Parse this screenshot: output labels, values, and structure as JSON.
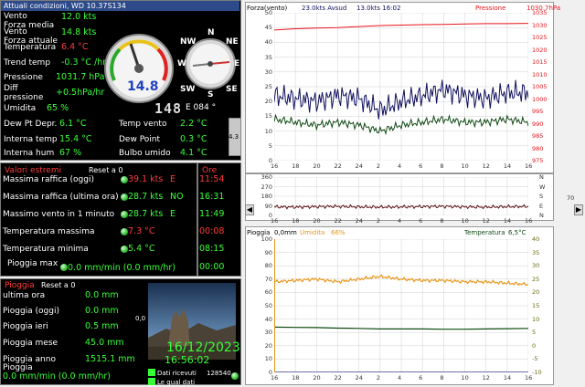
{
  "conditions": {
    "title": "Attuali condizioni, WD 10.37S134",
    "wind_avg_label": "Vento\nForza media",
    "wind_avg": "12.0 kts",
    "wind_now_label": "Vento\nForza attuale",
    "wind_now": "14.8 kts",
    "temp_label": "Temperatura",
    "temp": "6.4 °C",
    "trend_label": "Trend temp",
    "trend": "-0.3 °C /hr",
    "pressure_label": "Pressione",
    "pressure": "1031.7 hPa",
    "diff_label": "Diff\npressione",
    "diff": "+0.5hPa/hr",
    "humidity_label": "Umidita",
    "humidity": "65 %",
    "dew_label": "Dew Pt Depr.",
    "dew": "6.1 °C",
    "int_temp_label": "Interna temp",
    "int_temp": "15.4 °C",
    "int_hum_label": "Interna hum",
    "int_hum": "67 %",
    "wind_temp_label": "Temp vento",
    "wind_temp": "2.2 °C",
    "dew_point_label": "Dew Point",
    "dew_point": "0.3 °C",
    "wet_bulb_label": "Bulbo umido",
    "wet_bulb": "4.1 °C",
    "gauge_value": "14.8",
    "lcd_value": "148",
    "compass": {
      "nw": "NW",
      "n": "N",
      "ne": "NE",
      "w": "W",
      "e": "E",
      "sw": "SW",
      "s": "S",
      "se": "SE"
    },
    "direction": "E  084 °",
    "side_value": "4.3"
  },
  "extremes": {
    "title": "Valori estremi",
    "reset": "Reset a 0",
    "time_title": "Ore",
    "rows": [
      {
        "label": "Massima raffica (oggi)",
        "value": "39.1 kts",
        "dir": "E",
        "time": "11:54",
        "color": "red"
      },
      {
        "label": "Massima raffica (ultima ora)",
        "value": "28.7 kts",
        "dir": "NO",
        "time": "16:31",
        "color": "green"
      },
      {
        "label": "Massimo vento in 1 minuto",
        "value": "28.7 kts",
        "dir": "E",
        "time": "11:49",
        "color": "green"
      },
      {
        "label": "Temperatura massima",
        "value": "7.3 °C",
        "dir": "",
        "time": "00:08",
        "color": "red"
      },
      {
        "label": "Temperatura minima",
        "value": "5.4 °C",
        "dir": "",
        "time": "08:15",
        "color": "green"
      }
    ],
    "rain_max_label": "Pioggia max",
    "rain_max": "0.0 mm/min (0.0 mm/hr)",
    "rain_max_time": "00:00"
  },
  "rain": {
    "title": "Pioggia",
    "reset": "Reset a 0",
    "rows": [
      {
        "label": "ultima ora",
        "value": "0.0 mm"
      },
      {
        "label": "Pioggia (oggi)",
        "value": "0.0 mm"
      },
      {
        "label": "Pioggia ieri",
        "value": "0.5 mm"
      },
      {
        "label": "Pioggia mese",
        "value": "45.0 mm"
      },
      {
        "label": "Pioggia anno",
        "value": "1515.1 mm"
      }
    ],
    "rate_label": "Pioggia",
    "rate": "0.0 mm/min (0.0 mm/hr)",
    "cam_scale": "0,0",
    "date": "16/12/2023",
    "time": "16:56:02",
    "data_received_label": "Dati ricevuti",
    "data_received": "128540",
    "last_data_label": "Le qual dati"
  },
  "chart_data": [
    {
      "type": "line",
      "title": "",
      "legend": [
        "Forza(vento)",
        "23.0kts Avsud",
        "13.0kts 16:02",
        "Pressione",
        "1030.7hPa"
      ],
      "x": [
        "16",
        "18",
        "20",
        "22",
        "24",
        "2",
        "4",
        "6",
        "8",
        "10",
        "12",
        "14",
        "16"
      ],
      "y_left": {
        "ticks": [
          "50",
          "45",
          "40",
          "35",
          "30",
          "25",
          "20",
          "15",
          "10",
          "5",
          "0"
        ],
        "ylim": [
          0,
          50
        ]
      },
      "y_right": {
        "ticks": [
          "1035",
          "1030",
          "1025",
          "1020",
          "1015",
          "1010",
          "1005",
          "1000",
          "995",
          "990",
          "985",
          "980",
          "975"
        ],
        "ylim": [
          975,
          1035
        ]
      },
      "series": [
        {
          "name": "Pressione",
          "color": "#e8141a",
          "values": [
            1028,
            1028.5,
            1028.8,
            1029,
            1029.4,
            1029.8,
            1030,
            1030.2,
            1030.3,
            1030.5,
            1030.6,
            1030.6,
            1030.7
          ]
        },
        {
          "name": "Forza(vento)",
          "color": "#10105e",
          "values": [
            22,
            21,
            20,
            22,
            21,
            17,
            20,
            22,
            24,
            22,
            21,
            23,
            23
          ]
        },
        {
          "name": "Avsud",
          "color": "#0f4a12",
          "values": [
            14,
            13,
            12,
            13,
            12,
            10,
            12,
            13,
            14,
            13,
            13,
            14,
            13
          ]
        }
      ]
    },
    {
      "type": "line",
      "y_left": {
        "ticks": [
          "360",
          "270",
          "180",
          "90",
          "0"
        ],
        "ylim": [
          0,
          360
        ]
      },
      "y_right_labels": [
        "N",
        "W",
        "S",
        "E",
        "N"
      ],
      "right_value": "70",
      "x": [
        "16",
        "18",
        "20",
        "22",
        "24",
        "2",
        "4",
        "6",
        "8",
        "10",
        "12",
        "14",
        "16"
      ],
      "series": [
        {
          "name": "Direzione",
          "color": "#5a1010",
          "values": [
            80,
            78,
            82,
            85,
            80,
            78,
            80,
            83,
            85,
            80,
            78,
            82,
            84
          ]
        }
      ]
    },
    {
      "type": "line",
      "legend": [
        "Pioggia",
        "0,0mm",
        "Umidita",
        "66%",
        "Temperatura",
        "6,5°C"
      ],
      "y_left": {
        "ticks": [
          "100",
          "90",
          "80",
          "70",
          "60",
          "50",
          "40",
          "30",
          "20",
          "10",
          "0"
        ],
        "ylim": [
          0,
          100
        ]
      },
      "y_right": {
        "ticks": [
          "40",
          "35",
          "30",
          "25",
          "20",
          "15",
          "10",
          "5",
          "0",
          "-5",
          "-10"
        ],
        "ylim": [
          -10,
          40
        ]
      },
      "x": [
        "16",
        "18",
        "20",
        "22",
        "24",
        "2",
        "4",
        "6",
        "8",
        "10",
        "12",
        "14",
        "16"
      ],
      "series": [
        {
          "name": "Umidita",
          "color": "#e8961a",
          "values": [
            68,
            69,
            70,
            68,
            70,
            72,
            70,
            69,
            69,
            68,
            68,
            67,
            66
          ]
        },
        {
          "name": "Temperatura",
          "color": "#0f4a12",
          "values": [
            7.0,
            6.9,
            6.8,
            6.6,
            6.5,
            6.3,
            6.3,
            6.3,
            6.2,
            6.2,
            6.3,
            6.4,
            6.5
          ]
        },
        {
          "name": "Pioggia",
          "color": "#1a1a6e",
          "values": [
            0,
            0,
            0,
            0,
            0,
            0,
            0,
            0,
            0,
            0,
            0,
            0,
            0
          ]
        }
      ]
    }
  ]
}
